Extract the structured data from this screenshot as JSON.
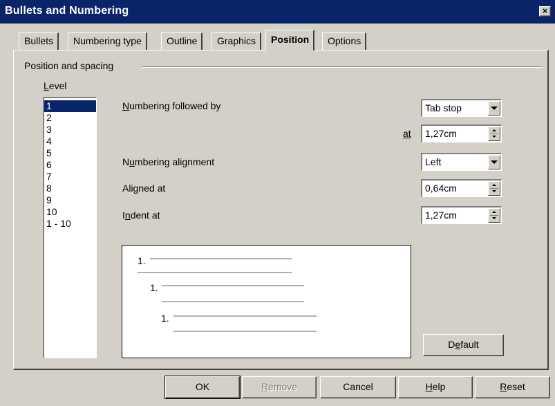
{
  "window": {
    "title": "Bullets and Numbering",
    "close_label": "×"
  },
  "tabs": [
    {
      "label": "Bullets",
      "active": false
    },
    {
      "label": "Numbering type",
      "active": false
    },
    {
      "label": "Outline",
      "active": false
    },
    {
      "label": "Graphics",
      "active": false
    },
    {
      "label": "Position",
      "active": true
    },
    {
      "label": "Options",
      "active": false
    }
  ],
  "group": {
    "title": "Position and spacing"
  },
  "level": {
    "label": "Level",
    "items": [
      "1",
      "2",
      "3",
      "4",
      "5",
      "6",
      "7",
      "8",
      "9",
      "10",
      "1 - 10"
    ],
    "selected": "1"
  },
  "fields": {
    "numbering_followed_by": {
      "label": "Numbering followed by",
      "value": "Tab stop"
    },
    "at": {
      "label": "at",
      "value": "1,27cm"
    },
    "numbering_alignment": {
      "label": "Numbering alignment",
      "value": "Left"
    },
    "aligned_at": {
      "label": "Aligned at",
      "value": "0,64cm"
    },
    "indent_at": {
      "label": "Indent at",
      "value": "1,27cm"
    }
  },
  "preview": {
    "numbers": [
      "1.",
      "1.",
      "1."
    ]
  },
  "buttons": {
    "default": "Default",
    "ok": "OK",
    "remove": "Remove",
    "cancel": "Cancel",
    "help": "Help",
    "reset": "Reset"
  },
  "colors": {
    "titlebar": "#0a246a",
    "face": "#d4d0c8",
    "selection": "#0a246a"
  }
}
